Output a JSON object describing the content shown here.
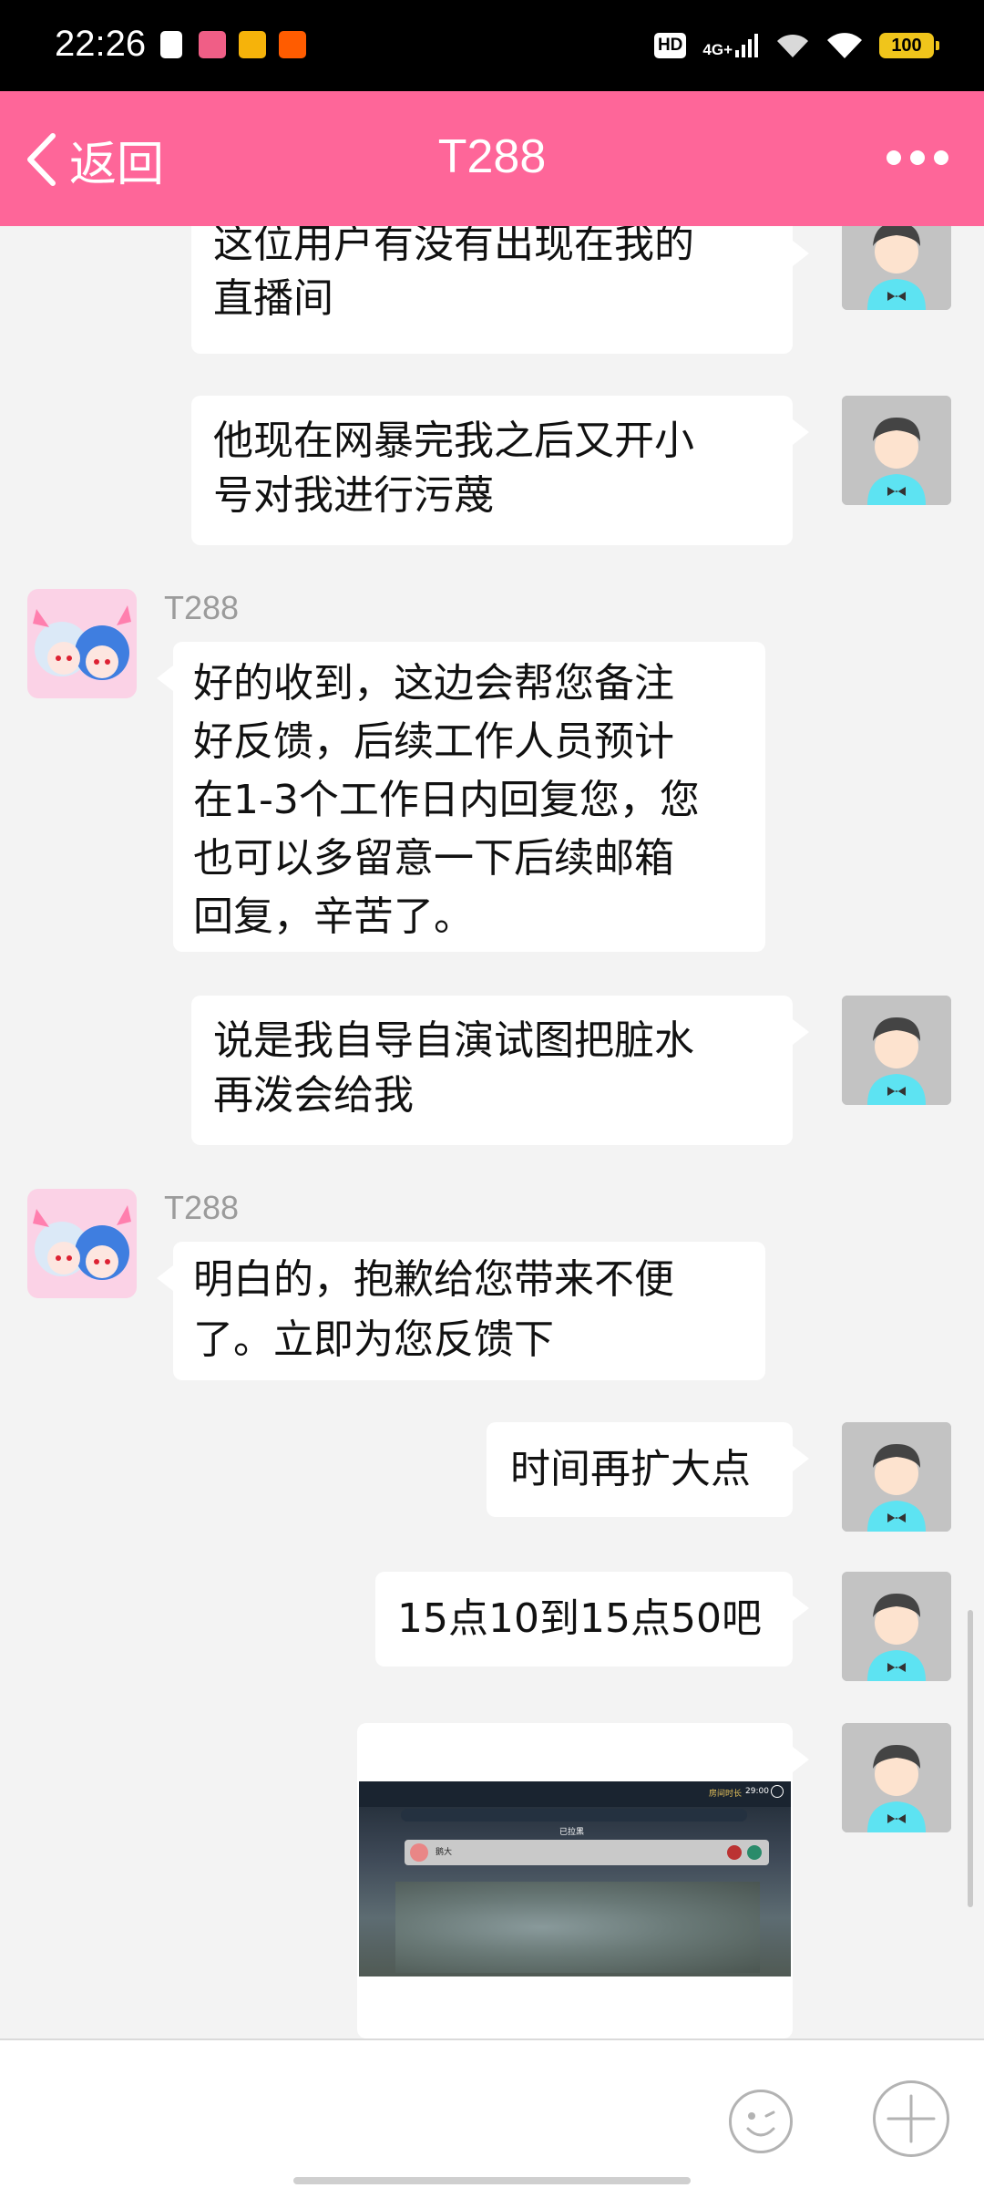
{
  "status_bar": {
    "time": "22:26",
    "hd": "HD",
    "network": "4G+",
    "battery": "100"
  },
  "header": {
    "back_label": "返回",
    "title": "T288"
  },
  "messages": [
    {
      "side": "right",
      "text_lines": [
        "这位用户有没有出现在我的",
        "直播间"
      ]
    },
    {
      "side": "right",
      "text_lines": [
        "他现在网暴完我之后又开小",
        "号对我进行污蔑"
      ]
    },
    {
      "side": "left",
      "sender": "T288",
      "text_lines": [
        "好的收到，这边会帮您备注",
        "好反馈，后续工作人员预计",
        "在1-3个工作日内回复您，您",
        "也可以多留意一下后续邮箱",
        "回复，辛苦了。"
      ]
    },
    {
      "side": "right",
      "text_lines": [
        "说是我自导自演试图把脏水",
        "再泼会给我"
      ]
    },
    {
      "side": "left",
      "sender": "T288",
      "text_lines": [
        "明白的，抱歉给您带来不便",
        "了。立即为您反馈下"
      ]
    },
    {
      "side": "right",
      "text_lines": [
        "时间再扩大点"
      ]
    },
    {
      "side": "right",
      "text_lines": [
        "15点10到15点50吧"
      ]
    },
    {
      "side": "right",
      "type": "image",
      "thumb_text": {
        "time_label": "房间时长",
        "time_value": "29:00",
        "tab_label": "已拉黑",
        "name": "鹅大"
      }
    }
  ],
  "colors": {
    "accent": "#fe6699",
    "bubble": "#ffffff",
    "background": "#f3f3f3",
    "user_avatar_shirt": "#5de3f2"
  },
  "icons": {
    "back": "chevron-left-icon",
    "more": "more-dots-icon",
    "emoji": "smiley-icon",
    "plus": "plus-icon"
  }
}
